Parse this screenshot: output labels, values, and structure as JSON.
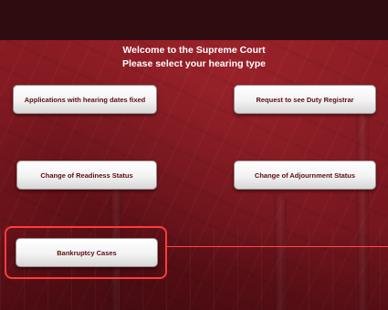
{
  "heading": {
    "line1": "Welcome to the Supreme Court",
    "line2": "Please select your hearing type"
  },
  "buttons": {
    "applications": "Applications with hearing dates fixed",
    "duty_registrar": "Request to see Duty Registrar",
    "readiness": "Change of Readiness Status",
    "adjournment": "Change of Adjournment Status",
    "bankruptcy": "Bankruptcy Cases"
  },
  "colors": {
    "background": "#7e1820",
    "top_bar": "#2e0c10",
    "button_text": "#5a0c12",
    "highlight": "#ff3b3b"
  }
}
